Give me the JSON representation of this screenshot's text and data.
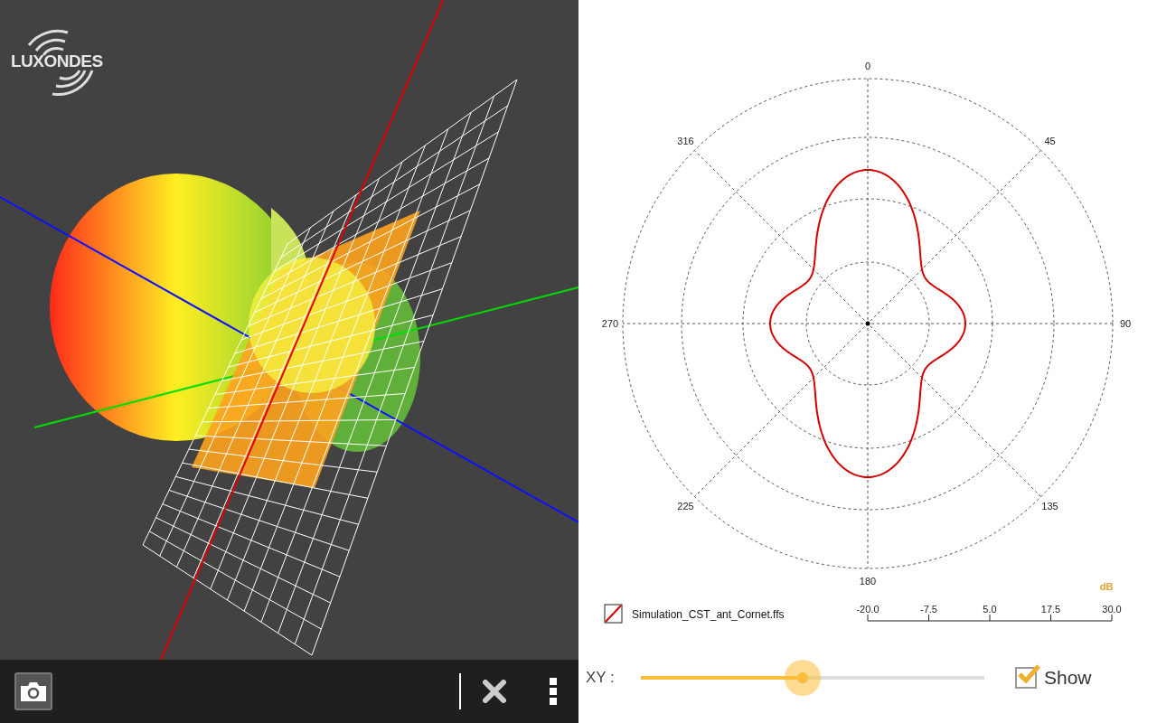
{
  "viewer": {
    "logo": "LUXONDES"
  },
  "polar_plot": {
    "angle_labels": [
      "0",
      "45",
      "90",
      "135",
      "180",
      "225",
      "270",
      "316"
    ],
    "scale_unit": "dB",
    "scale_labels": [
      "-20.0",
      "-7.5",
      "5.0",
      "17.5",
      "30.0"
    ],
    "legend": [
      {
        "label": "Simulation_CST_ant_Cornet.ffs"
      }
    ]
  },
  "plane_control": {
    "label": "XY :",
    "level": 0.47,
    "show": {
      "label": "Show",
      "checked": true
    }
  }
}
